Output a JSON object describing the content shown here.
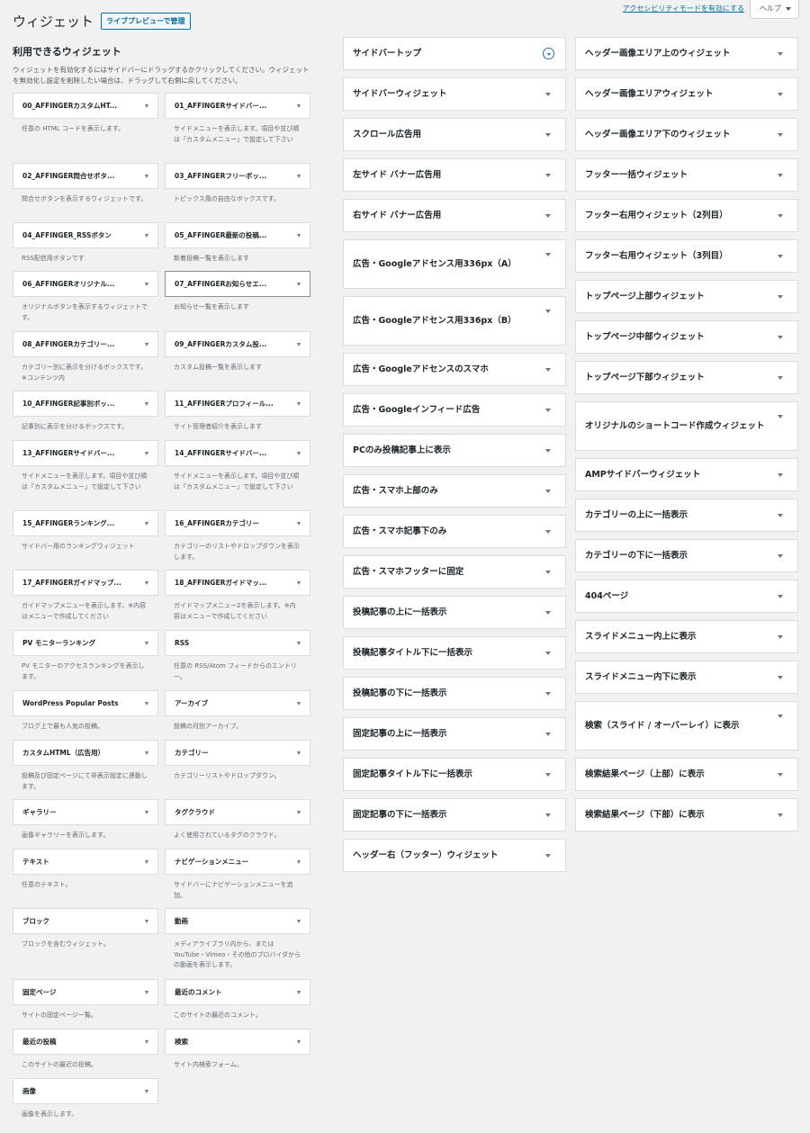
{
  "header": {
    "title": "ウィジェット",
    "manage_button": "ライブプレビューで管理",
    "a11y_link": "アクセシビリティモードを有効にする",
    "help": "ヘルプ"
  },
  "available": {
    "heading": "利用できるウィジェット",
    "description": "ウィジェットを有効化するにはサイドバーにドラッグするかクリックしてください。ウィジェットを無効化し設定を削除したい場合は、ドラッグして右側に戻してください。",
    "rows": [
      [
        {
          "title": "00_AFFINGERカスタムHT...",
          "desc": "任意の HTML コードを表示します。"
        },
        {
          "title": "01_AFFINGERサイドバー...",
          "desc": "サイドメニューを表示します。項目や並び順は「カスタムメニュー」で設定して下さい"
        }
      ],
      [
        {
          "title": "02_AFFINGER問合せボタ...",
          "desc": "問合せボタンを表示するウィジェットです。"
        },
        {
          "title": "03_AFFINGERフリーボッ...",
          "desc": "トピックス風の自由なボックスです。"
        }
      ],
      [
        {
          "title": "04_AFFINGER_RSSボタン",
          "desc": "RSS配信用ボタンです"
        },
        {
          "title": "05_AFFINGER最新の投稿...",
          "desc": "新着投稿一覧を表示します"
        }
      ],
      [
        {
          "title": "06_AFFINGERオリジナル...",
          "desc": "オリジナルボタンを表示するウィジェットです。"
        },
        {
          "title": "07_AFFINGERお知らせエ...",
          "desc": "お知らせ一覧を表示します",
          "hl": true
        }
      ],
      [
        {
          "title": "08_AFFINGERカテゴリー...",
          "desc": "カテゴリー別に表示を分けるボックスです。※コンテンツ内"
        },
        {
          "title": "09_AFFINGERカスタム投...",
          "desc": "カスタム投稿一覧を表示します"
        }
      ],
      [
        {
          "title": "10_AFFINGER記事別ボッ...",
          "desc": "記事別に表示を分けるボックスです。"
        },
        {
          "title": "11_AFFINGERプロフィール...",
          "desc": "サイト管理者紹介を表示します"
        }
      ],
      [
        {
          "title": "13_AFFINGERサイドバー...",
          "desc": "サイドメニューを表示します。項目や並び順は「カスタムメニュー」で設定して下さい"
        },
        {
          "title": "14_AFFINGERサイドバー...",
          "desc": "サイドメニューを表示します。項目や並び順は「カスタムメニュー」で設定して下さい"
        }
      ],
      [
        {
          "title": "15_AFFINGERランキング...",
          "desc": "サイドバー用のランキングウィジェット"
        },
        {
          "title": "16_AFFINGERカテゴリー",
          "desc": "カテゴリーのリストやドロップダウンを表示します。"
        }
      ],
      [
        {
          "title": "17_AFFINGERガイドマップ...",
          "desc": "ガイドマップメニューを表示します。※内容はメニューで作成してください"
        },
        {
          "title": "18_AFFINGERガイドマッ...",
          "desc": "ガイドマップメニュー2を表示します。※内容はメニューで作成してください"
        }
      ],
      [
        {
          "title": "PV モニターランキング",
          "desc": "PV モニターのアクセスランキングを表示します。"
        },
        {
          "title": "RSS",
          "desc": "任意の RSS/Atom フィードからのエントリー。"
        }
      ],
      [
        {
          "title": "WordPress Popular Posts",
          "desc": "ブログ上で最も人気の投稿。"
        },
        {
          "title": "アーカイブ",
          "desc": "投稿の月別アーカイブ。"
        }
      ],
      [
        {
          "title": "カスタムHTML（広告用）",
          "desc": "投稿及び固定ページにて非表示設定に連動します。"
        },
        {
          "title": "カテゴリー",
          "desc": "カテゴリーリストやドロップダウン。"
        }
      ],
      [
        {
          "title": "ギャラリー",
          "desc": "画像ギャラリーを表示します。"
        },
        {
          "title": "タグクラウド",
          "desc": "よく使用されているタグのクラウド。"
        }
      ],
      [
        {
          "title": "テキスト",
          "desc": "任意のテキスト。"
        },
        {
          "title": "ナビゲーションメニュー",
          "desc": "サイドバーにナビゲーションメニューを追加。"
        }
      ],
      [
        {
          "title": "ブロック",
          "desc": "ブロックを含むウィジェット。"
        },
        {
          "title": "動画",
          "desc": "メディアライブラリ内から、または YouTube・Vimeo・その他のプロバイダからの動画を表示します。"
        }
      ],
      [
        {
          "title": "固定ページ",
          "desc": "サイトの固定ページ一覧。"
        },
        {
          "title": "最近のコメント",
          "desc": "このサイトの最近のコメント。"
        }
      ],
      [
        {
          "title": "最近の投稿",
          "desc": "このサイトの最近の投稿。"
        },
        {
          "title": "検索",
          "desc": "サイト内検索フォーム。"
        }
      ],
      [
        {
          "title": "画像",
          "desc": "画像を表示します。"
        }
      ]
    ]
  },
  "sidebars_col2": [
    {
      "title": "サイドバートップ",
      "active": true
    },
    {
      "title": "サイドバーウィジェット"
    },
    {
      "title": "スクロール広告用"
    },
    {
      "title": "左サイド バナー広告用"
    },
    {
      "title": "右サイド バナー広告用"
    },
    {
      "title": "広告・Googleアドセンス用336px（A）",
      "tall": true
    },
    {
      "title": "広告・Googleアドセンス用336px（B）",
      "tall": true
    },
    {
      "title": "広告・Googleアドセンスのスマホ"
    },
    {
      "title": "広告・Googleインフィード広告"
    },
    {
      "title": "PCのみ投稿記事上に表示"
    },
    {
      "title": "広告・スマホ上部のみ"
    },
    {
      "title": "広告・スマホ記事下のみ"
    },
    {
      "title": "広告・スマホフッターに固定"
    },
    {
      "title": "投稿記事の上に一括表示"
    },
    {
      "title": "投稿記事タイトル下に一括表示"
    },
    {
      "title": "投稿記事の下に一括表示"
    },
    {
      "title": "固定記事の上に一括表示"
    },
    {
      "title": "固定記事タイトル下に一括表示"
    },
    {
      "title": "固定記事の下に一括表示"
    },
    {
      "title": "ヘッダー右（フッター）ウィジェット"
    }
  ],
  "sidebars_col3": [
    {
      "title": "ヘッダー画像エリア上のウィジェット"
    },
    {
      "title": "ヘッダー画像エリアウィジェット"
    },
    {
      "title": "ヘッダー画像エリア下のウィジェット"
    },
    {
      "title": "フッター一括ウィジェット"
    },
    {
      "title": "フッター右用ウィジェット（2列目）"
    },
    {
      "title": "フッター右用ウィジェット（3列目）"
    },
    {
      "title": "トップページ上部ウィジェット"
    },
    {
      "title": "トップページ中部ウィジェット"
    },
    {
      "title": "トップページ下部ウィジェット"
    },
    {
      "title": "オリジナルのショートコード作成ウィジェット",
      "tall": true
    },
    {
      "title": "AMPサイドバーウィジェット"
    },
    {
      "title": "カテゴリーの上に一括表示"
    },
    {
      "title": "カテゴリーの下に一括表示"
    },
    {
      "title": "404ページ"
    },
    {
      "title": "スライドメニュー内上に表示"
    },
    {
      "title": "スライドメニュー内下に表示"
    },
    {
      "title": "検索（スライド / オーバーレイ）に表示",
      "tall": true
    },
    {
      "title": "検索結果ページ（上部）に表示"
    },
    {
      "title": "検索結果ページ（下部）に表示"
    }
  ]
}
